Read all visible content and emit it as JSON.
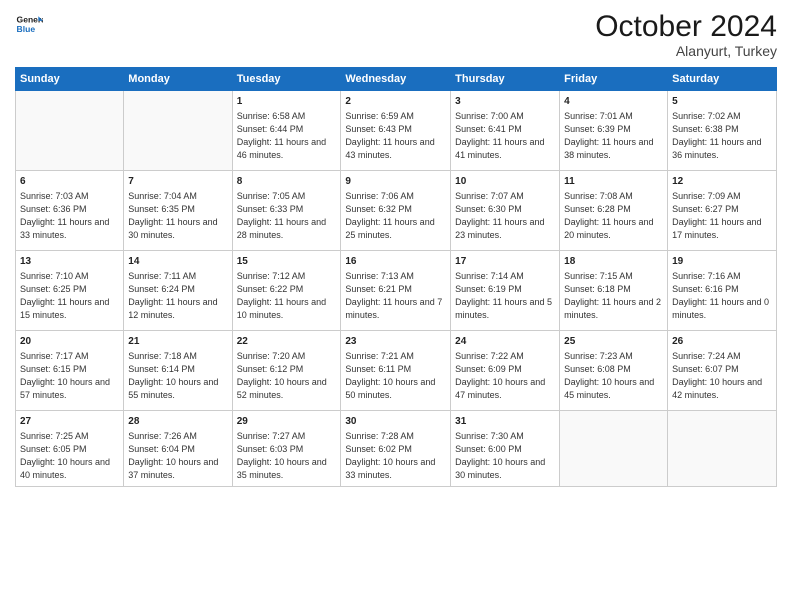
{
  "header": {
    "logo_line1": "General",
    "logo_line2": "Blue",
    "title": "October 2024",
    "subtitle": "Alanyurt, Turkey"
  },
  "weekdays": [
    "Sunday",
    "Monday",
    "Tuesday",
    "Wednesday",
    "Thursday",
    "Friday",
    "Saturday"
  ],
  "weeks": [
    [
      {
        "day": "",
        "sunrise": "",
        "sunset": "",
        "daylight": ""
      },
      {
        "day": "",
        "sunrise": "",
        "sunset": "",
        "daylight": ""
      },
      {
        "day": "1",
        "sunrise": "Sunrise: 6:58 AM",
        "sunset": "Sunset: 6:44 PM",
        "daylight": "Daylight: 11 hours and 46 minutes."
      },
      {
        "day": "2",
        "sunrise": "Sunrise: 6:59 AM",
        "sunset": "Sunset: 6:43 PM",
        "daylight": "Daylight: 11 hours and 43 minutes."
      },
      {
        "day": "3",
        "sunrise": "Sunrise: 7:00 AM",
        "sunset": "Sunset: 6:41 PM",
        "daylight": "Daylight: 11 hours and 41 minutes."
      },
      {
        "day": "4",
        "sunrise": "Sunrise: 7:01 AM",
        "sunset": "Sunset: 6:39 PM",
        "daylight": "Daylight: 11 hours and 38 minutes."
      },
      {
        "day": "5",
        "sunrise": "Sunrise: 7:02 AM",
        "sunset": "Sunset: 6:38 PM",
        "daylight": "Daylight: 11 hours and 36 minutes."
      }
    ],
    [
      {
        "day": "6",
        "sunrise": "Sunrise: 7:03 AM",
        "sunset": "Sunset: 6:36 PM",
        "daylight": "Daylight: 11 hours and 33 minutes."
      },
      {
        "day": "7",
        "sunrise": "Sunrise: 7:04 AM",
        "sunset": "Sunset: 6:35 PM",
        "daylight": "Daylight: 11 hours and 30 minutes."
      },
      {
        "day": "8",
        "sunrise": "Sunrise: 7:05 AM",
        "sunset": "Sunset: 6:33 PM",
        "daylight": "Daylight: 11 hours and 28 minutes."
      },
      {
        "day": "9",
        "sunrise": "Sunrise: 7:06 AM",
        "sunset": "Sunset: 6:32 PM",
        "daylight": "Daylight: 11 hours and 25 minutes."
      },
      {
        "day": "10",
        "sunrise": "Sunrise: 7:07 AM",
        "sunset": "Sunset: 6:30 PM",
        "daylight": "Daylight: 11 hours and 23 minutes."
      },
      {
        "day": "11",
        "sunrise": "Sunrise: 7:08 AM",
        "sunset": "Sunset: 6:28 PM",
        "daylight": "Daylight: 11 hours and 20 minutes."
      },
      {
        "day": "12",
        "sunrise": "Sunrise: 7:09 AM",
        "sunset": "Sunset: 6:27 PM",
        "daylight": "Daylight: 11 hours and 17 minutes."
      }
    ],
    [
      {
        "day": "13",
        "sunrise": "Sunrise: 7:10 AM",
        "sunset": "Sunset: 6:25 PM",
        "daylight": "Daylight: 11 hours and 15 minutes."
      },
      {
        "day": "14",
        "sunrise": "Sunrise: 7:11 AM",
        "sunset": "Sunset: 6:24 PM",
        "daylight": "Daylight: 11 hours and 12 minutes."
      },
      {
        "day": "15",
        "sunrise": "Sunrise: 7:12 AM",
        "sunset": "Sunset: 6:22 PM",
        "daylight": "Daylight: 11 hours and 10 minutes."
      },
      {
        "day": "16",
        "sunrise": "Sunrise: 7:13 AM",
        "sunset": "Sunset: 6:21 PM",
        "daylight": "Daylight: 11 hours and 7 minutes."
      },
      {
        "day": "17",
        "sunrise": "Sunrise: 7:14 AM",
        "sunset": "Sunset: 6:19 PM",
        "daylight": "Daylight: 11 hours and 5 minutes."
      },
      {
        "day": "18",
        "sunrise": "Sunrise: 7:15 AM",
        "sunset": "Sunset: 6:18 PM",
        "daylight": "Daylight: 11 hours and 2 minutes."
      },
      {
        "day": "19",
        "sunrise": "Sunrise: 7:16 AM",
        "sunset": "Sunset: 6:16 PM",
        "daylight": "Daylight: 11 hours and 0 minutes."
      }
    ],
    [
      {
        "day": "20",
        "sunrise": "Sunrise: 7:17 AM",
        "sunset": "Sunset: 6:15 PM",
        "daylight": "Daylight: 10 hours and 57 minutes."
      },
      {
        "day": "21",
        "sunrise": "Sunrise: 7:18 AM",
        "sunset": "Sunset: 6:14 PM",
        "daylight": "Daylight: 10 hours and 55 minutes."
      },
      {
        "day": "22",
        "sunrise": "Sunrise: 7:20 AM",
        "sunset": "Sunset: 6:12 PM",
        "daylight": "Daylight: 10 hours and 52 minutes."
      },
      {
        "day": "23",
        "sunrise": "Sunrise: 7:21 AM",
        "sunset": "Sunset: 6:11 PM",
        "daylight": "Daylight: 10 hours and 50 minutes."
      },
      {
        "day": "24",
        "sunrise": "Sunrise: 7:22 AM",
        "sunset": "Sunset: 6:09 PM",
        "daylight": "Daylight: 10 hours and 47 minutes."
      },
      {
        "day": "25",
        "sunrise": "Sunrise: 7:23 AM",
        "sunset": "Sunset: 6:08 PM",
        "daylight": "Daylight: 10 hours and 45 minutes."
      },
      {
        "day": "26",
        "sunrise": "Sunrise: 7:24 AM",
        "sunset": "Sunset: 6:07 PM",
        "daylight": "Daylight: 10 hours and 42 minutes."
      }
    ],
    [
      {
        "day": "27",
        "sunrise": "Sunrise: 7:25 AM",
        "sunset": "Sunset: 6:05 PM",
        "daylight": "Daylight: 10 hours and 40 minutes."
      },
      {
        "day": "28",
        "sunrise": "Sunrise: 7:26 AM",
        "sunset": "Sunset: 6:04 PM",
        "daylight": "Daylight: 10 hours and 37 minutes."
      },
      {
        "day": "29",
        "sunrise": "Sunrise: 7:27 AM",
        "sunset": "Sunset: 6:03 PM",
        "daylight": "Daylight: 10 hours and 35 minutes."
      },
      {
        "day": "30",
        "sunrise": "Sunrise: 7:28 AM",
        "sunset": "Sunset: 6:02 PM",
        "daylight": "Daylight: 10 hours and 33 minutes."
      },
      {
        "day": "31",
        "sunrise": "Sunrise: 7:30 AM",
        "sunset": "Sunset: 6:00 PM",
        "daylight": "Daylight: 10 hours and 30 minutes."
      },
      {
        "day": "",
        "sunrise": "",
        "sunset": "",
        "daylight": ""
      },
      {
        "day": "",
        "sunrise": "",
        "sunset": "",
        "daylight": ""
      }
    ]
  ]
}
